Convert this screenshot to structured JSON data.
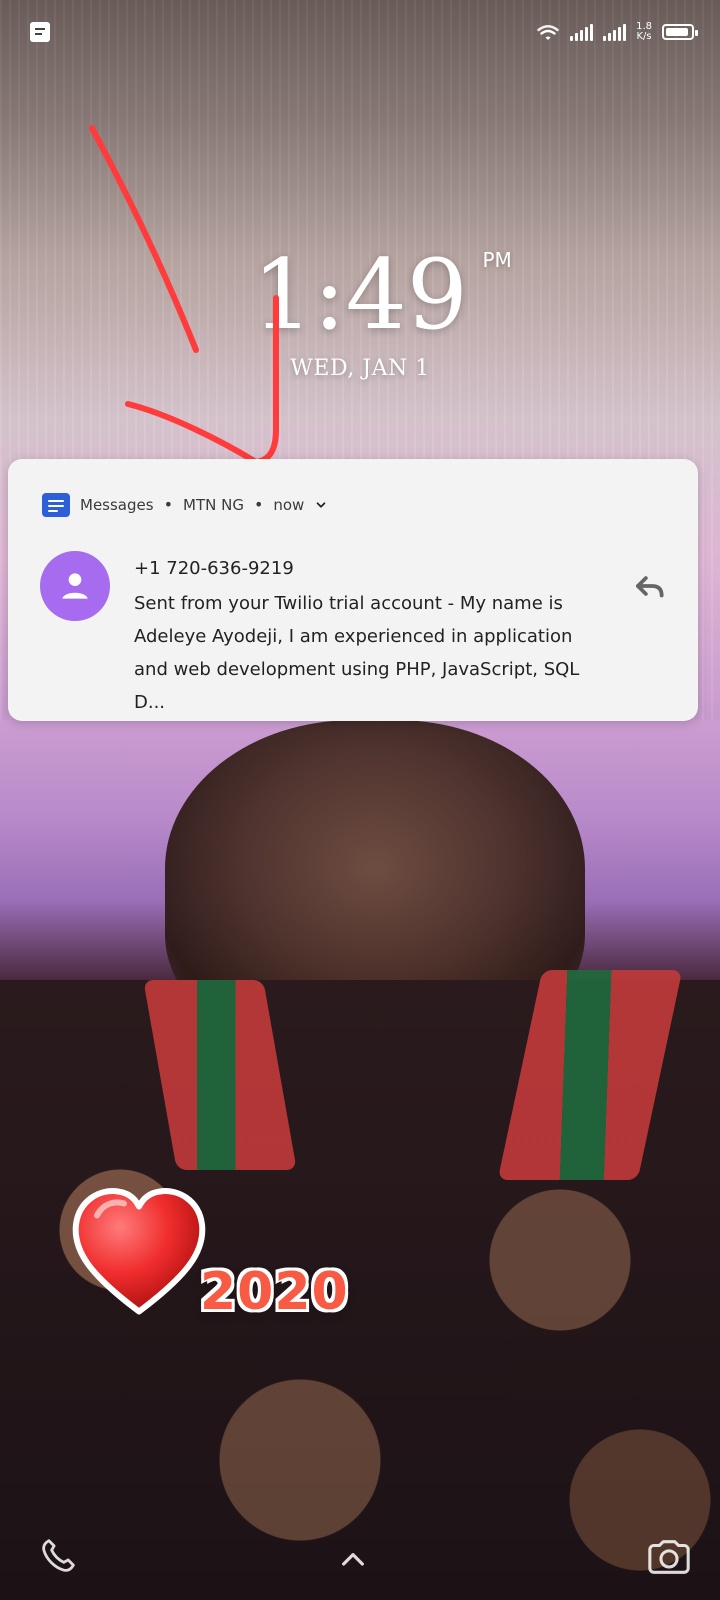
{
  "status_bar": {
    "network_speed_value": "1.8",
    "network_speed_unit": "K/s",
    "battery_level": 0.9
  },
  "lockscreen": {
    "time": "1:49",
    "ampm": "PM",
    "date": "WED, JAN 1"
  },
  "notification": {
    "app": "Messages",
    "carrier": "MTN NG",
    "when": "now",
    "title": "+1 720-636-9219",
    "text": "Sent from your Twilio trial account - My name is Adeleye Ayodeji, I am experienced in application and web development using PHP, JavaScript, SQL D..."
  },
  "sticker": {
    "text": "2020"
  },
  "colors": {
    "avatar_purple": "#a76bf0",
    "messages_blue": "#2d60d8",
    "annotation_red": "#ff3b3b"
  }
}
